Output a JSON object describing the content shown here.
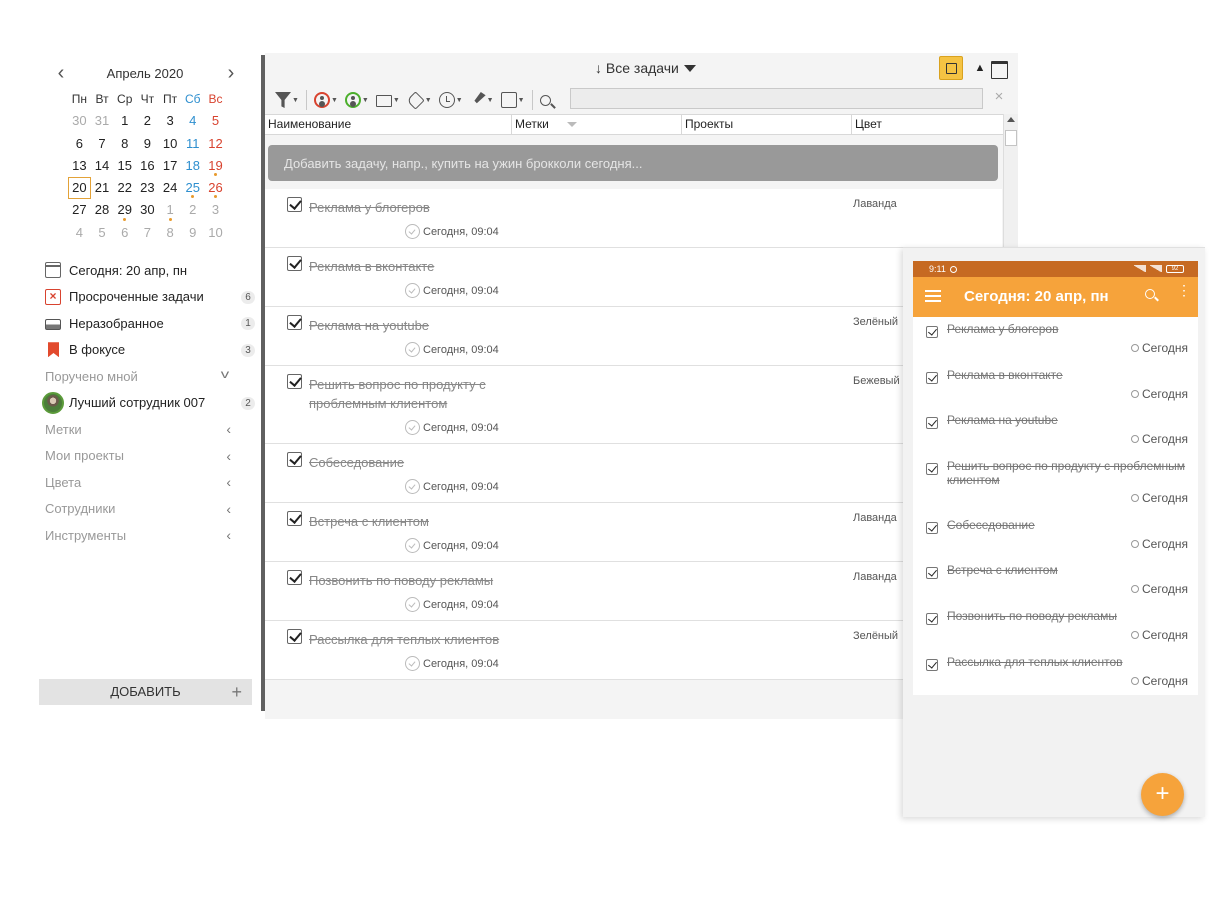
{
  "calendar": {
    "month_label": "Апрель 2020",
    "prev_label": "‹",
    "next_label": "›",
    "weekdays": [
      "Пн",
      "Вт",
      "Ср",
      "Чт",
      "Пт",
      "Сб",
      "Вс"
    ],
    "weeks": [
      [
        "30",
        "31",
        "1",
        "2",
        "3",
        "4",
        "5"
      ],
      [
        "6",
        "7",
        "8",
        "9",
        "10",
        "11",
        "12"
      ],
      [
        "13",
        "14",
        "15",
        "16",
        "17",
        "18",
        "19"
      ],
      [
        "20",
        "21",
        "22",
        "23",
        "24",
        "25",
        "26"
      ],
      [
        "27",
        "28",
        "29",
        "30",
        "1",
        "2",
        "3"
      ],
      [
        "4",
        "5",
        "6",
        "7",
        "8",
        "9",
        "10"
      ]
    ],
    "today": "20"
  },
  "sidebar": {
    "today": "Сегодня: 20 апр, пн",
    "overdue": "Просроченные задачи",
    "overdue_count": "6",
    "inbox": "Неразобранное",
    "inbox_count": "1",
    "focus": "В фокусе",
    "focus_count": "3",
    "assigned_by_me": "Поручено мной",
    "employee": "Лучший сотрудник 007",
    "employee_count": "2",
    "tags": "Метки",
    "projects": "Мои проекты",
    "colors": "Цвета",
    "employees": "Сотрудники",
    "tools": "Инструменты",
    "add_label": "ДОБАВИТЬ",
    "add_plus": "+"
  },
  "main": {
    "title": "↓ Все задачи",
    "columns": [
      "Наименование",
      "Метки",
      "Проекты",
      "Цвет"
    ],
    "add_placeholder": "Добавить задачу, напр., купить на ужин брокколи сегодня...",
    "search_value": "",
    "clear_label": "×",
    "up_label": "▲",
    "tasks": [
      {
        "name": "Реклама у блогеров",
        "due": "Сегодня, 09:04",
        "color": "Лаванда"
      },
      {
        "name": "Реклама в вконтакте",
        "due": "Сегодня, 09:04",
        "color": ""
      },
      {
        "name": "Реклама на youtube",
        "due": "Сегодня, 09:04",
        "color": "Зелёный"
      },
      {
        "name": "Решить вопрос по продукту с проблемным клиентом",
        "due": "Сегодня, 09:04",
        "color": "Бежевый"
      },
      {
        "name": "Собеседование",
        "due": "Сегодня, 09:04",
        "color": ""
      },
      {
        "name": "Встреча с клиентом",
        "due": "Сегодня, 09:04",
        "color": "Лаванда"
      },
      {
        "name": "Позвонить по поводу рекламы",
        "due": "Сегодня, 09:04",
        "color": "Лаванда"
      },
      {
        "name": "Рассылка для теплых клиентов",
        "due": "Сегодня, 09:04",
        "color": "Зелёный"
      }
    ]
  },
  "phone": {
    "time": "9:11",
    "battery": "92",
    "title": "Сегодня: 20 апр, пн",
    "more_label": "⋮",
    "fab_label": "+",
    "tasks": [
      {
        "name": "Реклама у блогеров",
        "due": "Сегодня"
      },
      {
        "name": "Реклама в вконтакте",
        "due": "Сегодня"
      },
      {
        "name": "Реклама на youtube",
        "due": "Сегодня"
      },
      {
        "name": "Решить вопрос по продукту с проблемным клиентом",
        "due": "Сегодня"
      },
      {
        "name": "Собеседование",
        "due": "Сегодня"
      },
      {
        "name": "Встреча с клиентом",
        "due": "Сегодня"
      },
      {
        "name": "Позвонить по поводу рекламы",
        "due": "Сегодня"
      },
      {
        "name": "Рассылка для теплых клиентов",
        "due": "Сегодня"
      }
    ]
  },
  "colors": {
    "accent_orange": "#f6a33b",
    "status_bar": "#c66a22",
    "weekend_blue": "#2e8fcf",
    "weekend_red": "#d8432f",
    "today_outline": "#e3a238"
  }
}
